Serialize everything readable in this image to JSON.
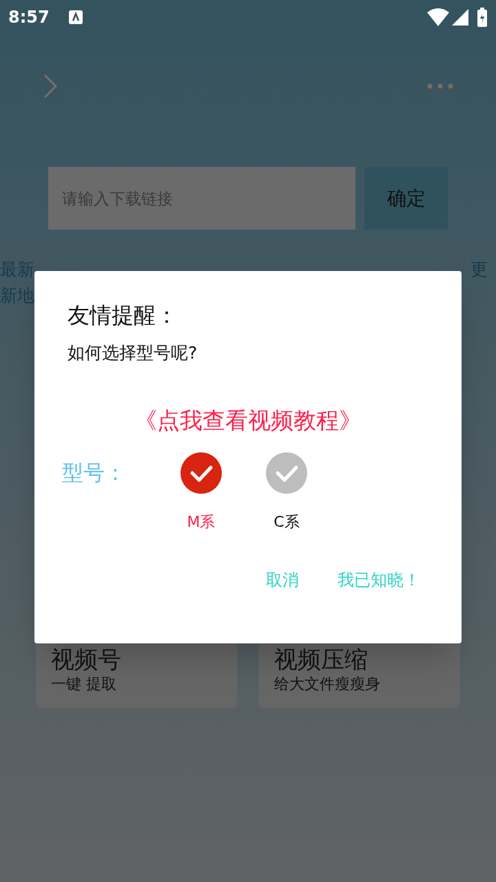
{
  "status_bar": {
    "time": "8:57"
  },
  "input": {
    "placeholder": "请输入下载链接"
  },
  "confirm_button": "确定",
  "notice": {
    "line_1_left": "最新",
    "line_1_right": "更",
    "line_2_left": "新地"
  },
  "cards": [
    {
      "title": "视频号",
      "subtitle": "一键 提取"
    },
    {
      "title": "视频压缩",
      "subtitle": "给大文件瘦瘦身"
    }
  ],
  "dialog": {
    "title": "友情提醒：",
    "question": "如何选择型号呢?",
    "link": "《点我查看视频教程》",
    "model_label": "型号：",
    "options": [
      {
        "label": "M系",
        "selected": true
      },
      {
        "label": "C系",
        "selected": false
      }
    ],
    "buttons": [
      "取消",
      "我已知晓！"
    ]
  }
}
